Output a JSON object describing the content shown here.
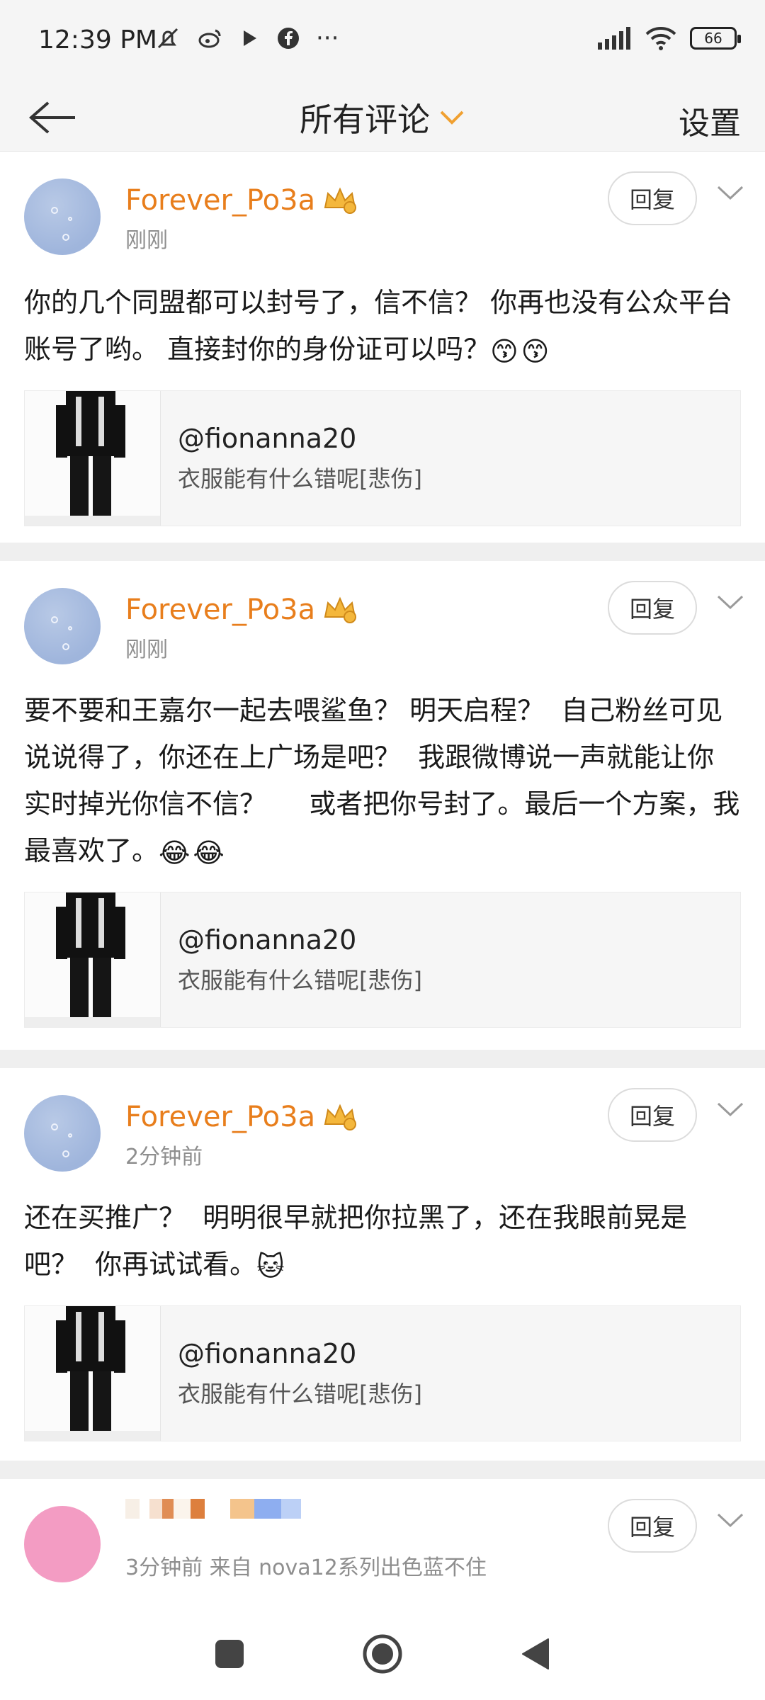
{
  "status_bar": {
    "time": "12:39 PM",
    "battery": "66",
    "more": "···"
  },
  "header": {
    "title": "所有评论",
    "settings": "设置"
  },
  "comments": [
    {
      "user": "Forever_Po3a",
      "time": "刚刚",
      "reply": "回复",
      "text": "你的几个同盟都可以封号了，信不信？ 你再也没有公众平台账号了哟。 直接封你的身份证可以吗？",
      "emojis": [
        "😙",
        "😙"
      ],
      "quote_user": "@fionanna20",
      "quote_text": "衣服能有什么错呢[悲伤]"
    },
    {
      "user": "Forever_Po3a",
      "time": "刚刚",
      "reply": "回复",
      "text": "要不要和王嘉尔一起去喂鲨鱼？ 明天启程？  自己粉丝可见说说得了，你还在上广场是吧？  我跟微博说一声就能让你实时掉光你信不信？     或者把你号封了。最后一个方案，我最喜欢了。",
      "emojis": [
        "😂",
        "😂"
      ],
      "quote_user": "@fionanna20",
      "quote_text": "衣服能有什么错呢[悲伤]"
    },
    {
      "user": "Forever_Po3a",
      "time": "2分钟前",
      "reply": "回复",
      "text": "还在买推广？  明明很早就把你拉黑了，还在我眼前晃是吧？  你再试试看。",
      "emojis": [
        "🐱"
      ],
      "quote_user": "@fionanna20",
      "quote_text": "衣服能有什么错呢[悲伤]"
    },
    {
      "time": "3分钟前   来自 nova12系列出色蓝不住",
      "reply": "回复"
    }
  ],
  "colors": {
    "username": "#e87e1c",
    "accent_chevron": "#f0a030",
    "separator": "#efefef"
  },
  "icons": {
    "back": "arrow-left-icon",
    "dropdown": "chevron-down-icon",
    "home": "circle-home-icon",
    "recents": "square-recents-icon",
    "back_nav": "triangle-back-icon"
  }
}
